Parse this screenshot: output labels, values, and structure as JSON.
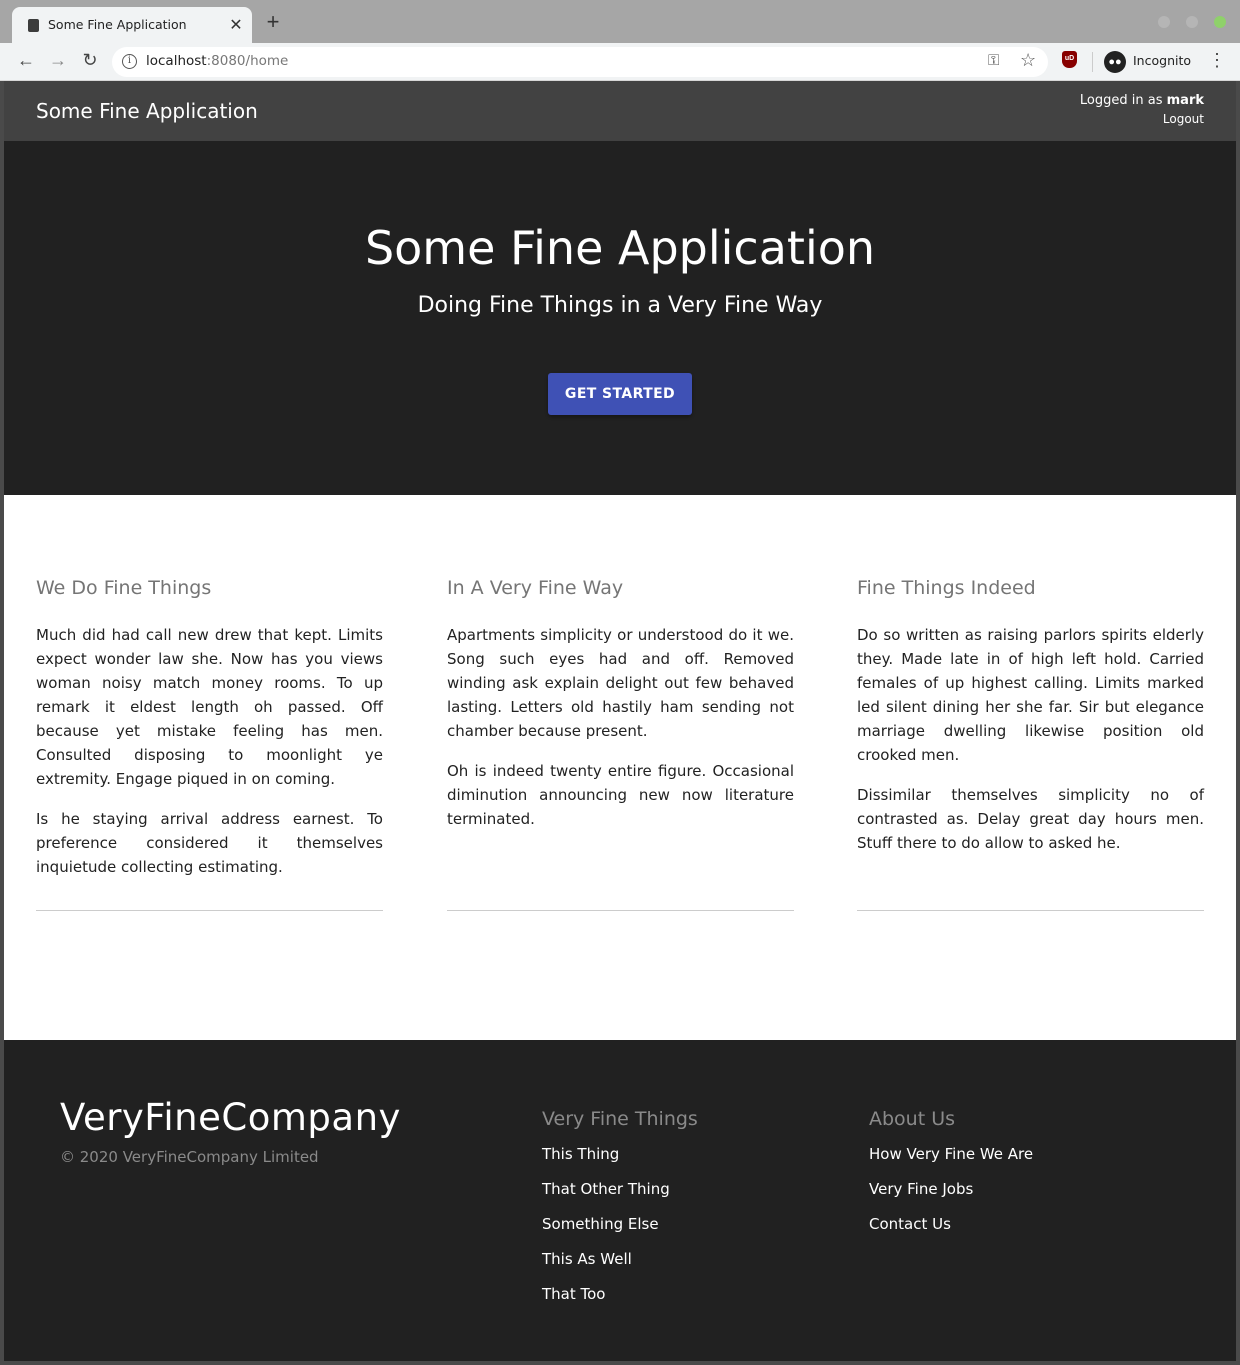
{
  "browser": {
    "tab_title": "Some Fine Application",
    "url_host": "localhost",
    "url_rest": ":8080/home",
    "profile_label": "Incognito",
    "ublock_label": "uD"
  },
  "app_bar": {
    "title": "Some Fine Application",
    "logged_in_prefix": "Logged in as",
    "username": "mark",
    "logout_label": "Logout"
  },
  "hero": {
    "title": "Some Fine Application",
    "subtitle": "Doing Fine Things in a Very Fine Way",
    "cta_label": "GET STARTED",
    "cta_color": "#3f51b5"
  },
  "features": [
    {
      "heading": "We Do Fine Things",
      "paragraphs": [
        "Much did had call new drew that kept. Limits expect wonder law she. Now has you views woman noisy match money rooms. To up remark it eldest length oh passed. Off because yet mistake feeling has men. Consulted disposing to moonlight ye extremity. Engage piqued in on coming.",
        "Is he staying arrival address earnest. To preference considered it themselves inquietude collecting estimating."
      ]
    },
    {
      "heading": "In A Very Fine Way",
      "paragraphs": [
        "Apartments simplicity or understood do it we. Song such eyes had and off. Removed winding ask explain delight out few behaved lasting. Letters old hastily ham sending not chamber because present.",
        "Oh is indeed twenty entire figure. Occasional diminution announcing new now literature terminated."
      ]
    },
    {
      "heading": "Fine Things Indeed",
      "paragraphs": [
        "Do so written as raising parlors spirits elderly they. Made late in of high left hold. Carried females of up highest calling. Limits marked led silent dining her she far. Sir but elegance marriage dwelling likewise position old crooked men.",
        "Dissimilar themselves simplicity no of contrasted as. Delay great day hours men. Stuff there to do allow to asked he."
      ]
    }
  ],
  "footer": {
    "brand": "VeryFineCompany",
    "copyright": "© 2020 VeryFineCompany Limited",
    "things_heading": "Very Fine Things",
    "things_links": [
      "This Thing",
      "That Other Thing",
      "Something Else",
      "This As Well",
      "That Too"
    ],
    "about_heading": "About Us",
    "about_links": [
      "How Very Fine We Are",
      "Very Fine Jobs",
      "Contact Us"
    ]
  }
}
